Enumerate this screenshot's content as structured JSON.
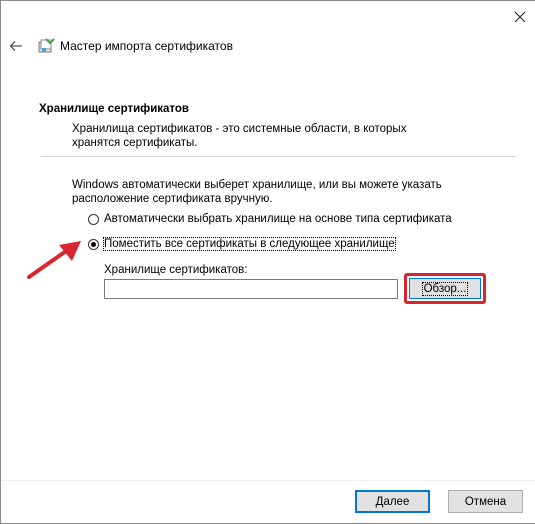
{
  "window": {
    "title": "Мастер импорта сертификатов",
    "close_icon": "close-icon",
    "back_icon": "back-arrow-icon",
    "app_icon": "certificate-wizard-icon"
  },
  "section": {
    "title": "Хранилище сертификатов",
    "description": "Хранилища сертификатов - это системные области, в которых хранятся сертификаты."
  },
  "main": {
    "intro": "Windows автоматически выберет хранилище, или вы можете указать расположение сертификата вручную.",
    "radio_auto": {
      "label": "Автоматически выбрать хранилище на основе типа сертификата",
      "checked": false
    },
    "radio_manual": {
      "label": "Поместить все сертификаты в следующее хранилище",
      "checked": true
    },
    "store_label": "Хранилище сертификатов:",
    "store_value": "",
    "browse_label": "Обзор..."
  },
  "footer": {
    "next_label": "Далее",
    "cancel_label": "Отмена"
  },
  "annotations": {
    "arrow_color": "#d9252f",
    "highlight_color": "#d9252f"
  }
}
